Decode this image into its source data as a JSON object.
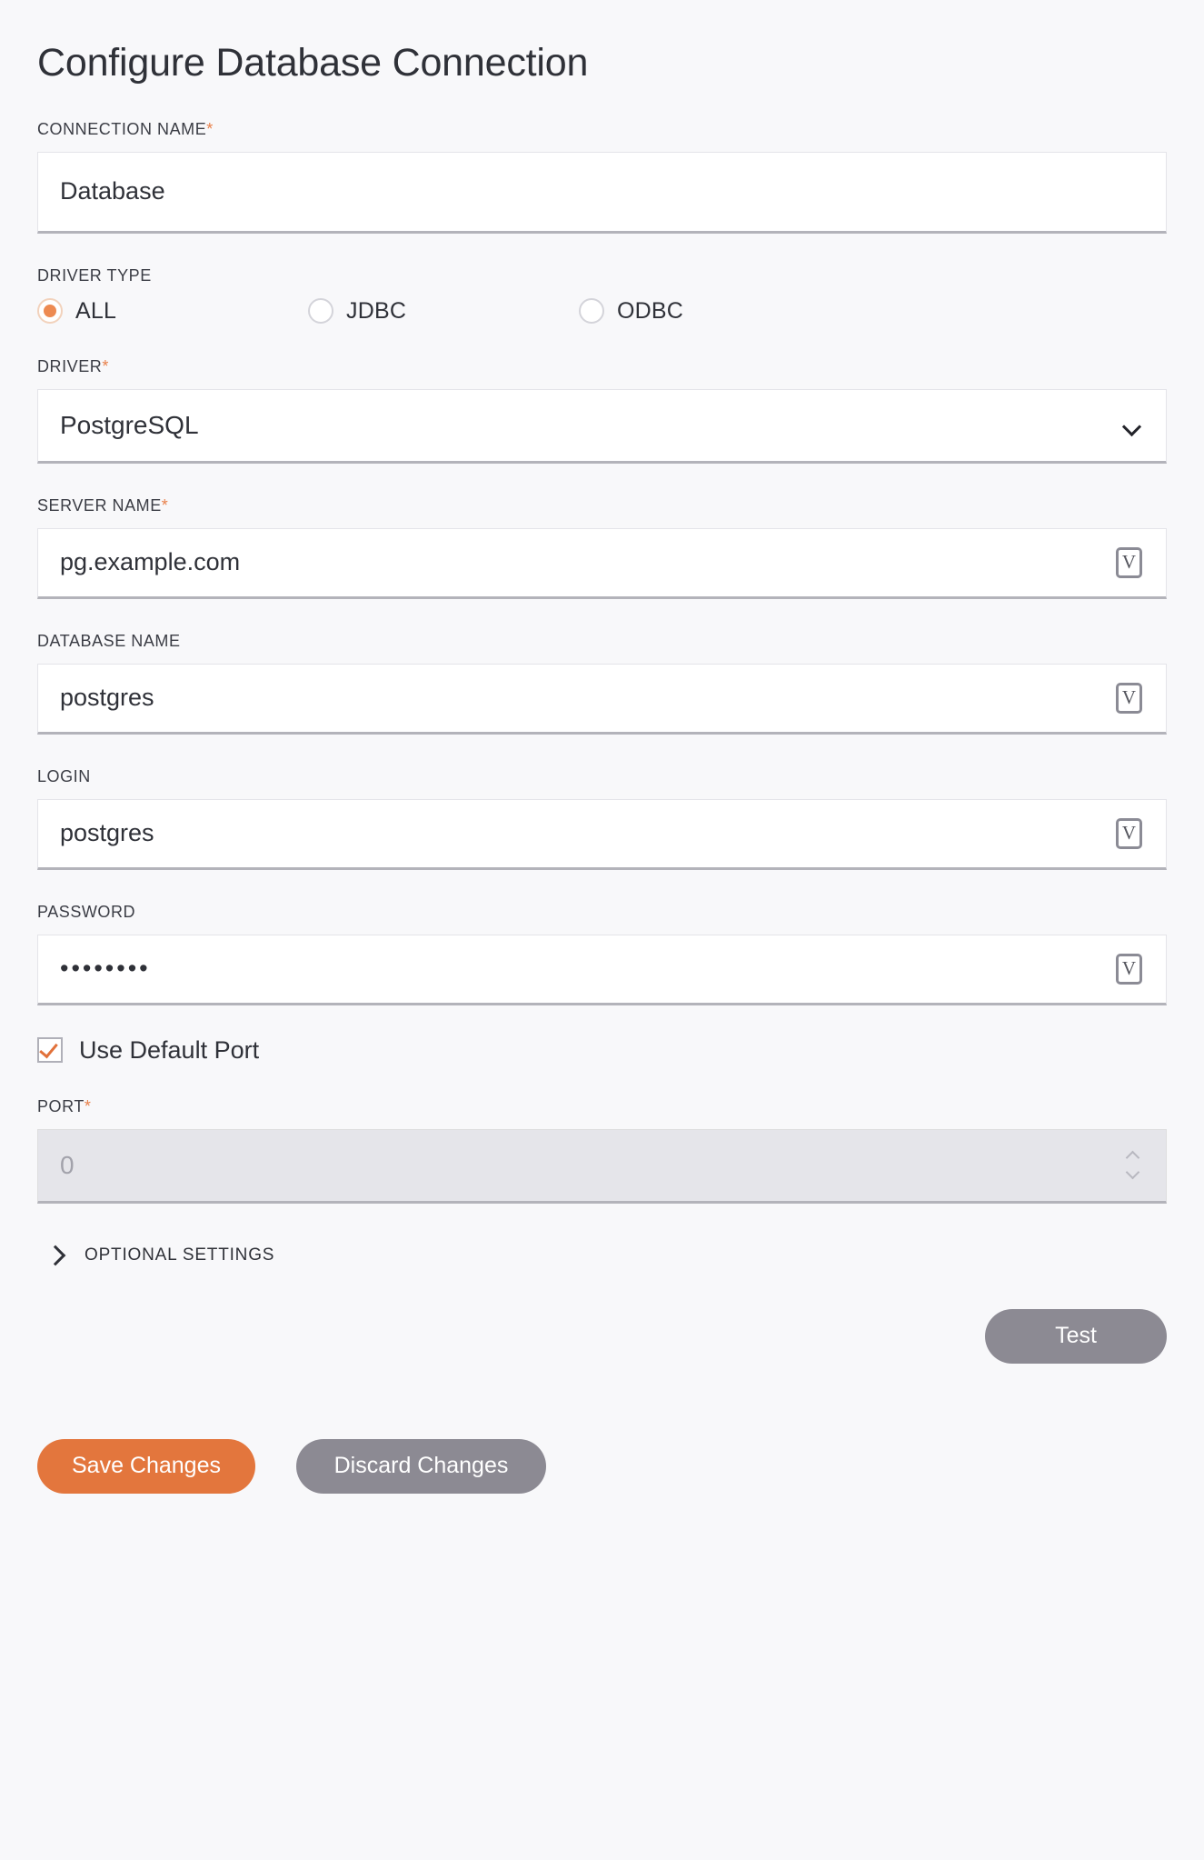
{
  "title": "Configure Database Connection",
  "fields": {
    "connection_name": {
      "label": "CONNECTION NAME",
      "required_marker": "*",
      "value": "Database"
    },
    "driver_type": {
      "label": "DRIVER TYPE",
      "options": [
        {
          "label": "ALL",
          "selected": true
        },
        {
          "label": "JDBC",
          "selected": false
        },
        {
          "label": "ODBC",
          "selected": false
        }
      ]
    },
    "driver": {
      "label": "DRIVER",
      "required_marker": "*",
      "value": "PostgreSQL",
      "chevron_icon": "chevron-down-icon"
    },
    "server_name": {
      "label": "SERVER NAME",
      "required_marker": "*",
      "value": "pg.example.com",
      "variable_icon": "V"
    },
    "database_name": {
      "label": "DATABASE NAME",
      "value": "postgres",
      "variable_icon": "V"
    },
    "login": {
      "label": "LOGIN",
      "value": "postgres",
      "variable_icon": "V"
    },
    "password": {
      "label": "PASSWORD",
      "value": "••••••••",
      "variable_icon": "V"
    },
    "use_default_port": {
      "label": "Use Default Port",
      "checked": true
    },
    "port": {
      "label": "PORT",
      "required_marker": "*",
      "value": "0",
      "disabled": true
    }
  },
  "optional_settings": {
    "label": "OPTIONAL SETTINGS",
    "expanded": false,
    "chevron_icon": "chevron-right-icon"
  },
  "buttons": {
    "test": "Test",
    "save": "Save Changes",
    "discard": "Discard Changes"
  },
  "colors": {
    "accent": "#e3763d",
    "required": "#e8804a",
    "muted_button": "#8c8a93",
    "page_bg": "#f8f8fa",
    "input_bg": "#ffffff",
    "disabled_bg": "#e5e5ea"
  }
}
